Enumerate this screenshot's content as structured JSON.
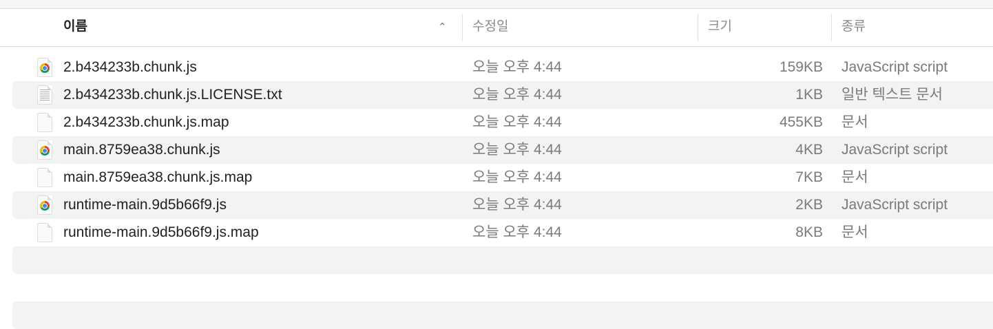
{
  "columns": {
    "name": "이름",
    "modified": "수정일",
    "size": "크기",
    "kind": "종류"
  },
  "files": [
    {
      "name": "2.b434233b.chunk.js",
      "modified": "오늘 오후 4:44",
      "size": "159KB",
      "kind": "JavaScript script",
      "icon": "chrome-js-icon"
    },
    {
      "name": "2.b434233b.chunk.js.LICENSE.txt",
      "modified": "오늘 오후 4:44",
      "size": "1KB",
      "kind": "일반 텍스트 문서",
      "icon": "text-file-icon"
    },
    {
      "name": "2.b434233b.chunk.js.map",
      "modified": "오늘 오후 4:44",
      "size": "455KB",
      "kind": "문서",
      "icon": "document-icon"
    },
    {
      "name": "main.8759ea38.chunk.js",
      "modified": "오늘 오후 4:44",
      "size": "4KB",
      "kind": "JavaScript script",
      "icon": "chrome-js-icon"
    },
    {
      "name": "main.8759ea38.chunk.js.map",
      "modified": "오늘 오후 4:44",
      "size": "7KB",
      "kind": "문서",
      "icon": "document-icon"
    },
    {
      "name": "runtime-main.9d5b66f9.js",
      "modified": "오늘 오후 4:44",
      "size": "2KB",
      "kind": "JavaScript script",
      "icon": "chrome-js-icon"
    },
    {
      "name": "runtime-main.9d5b66f9.js.map",
      "modified": "오늘 오후 4:44",
      "size": "8KB",
      "kind": "문서",
      "icon": "document-icon"
    }
  ]
}
